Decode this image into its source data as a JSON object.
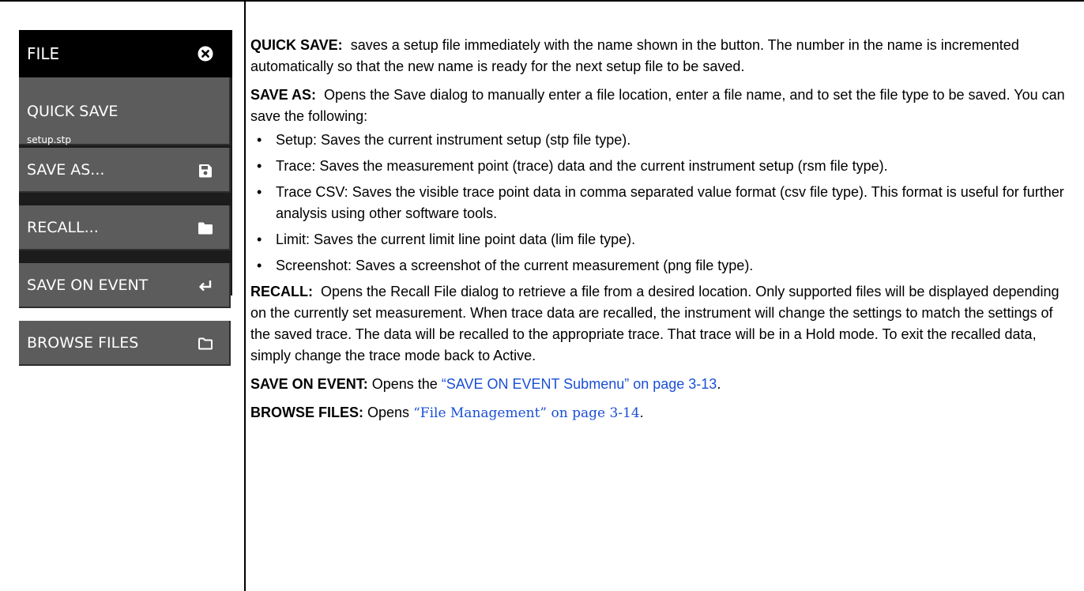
{
  "menu": {
    "title": "FILE",
    "close_icon": "close-circle-icon",
    "items": [
      {
        "label": "QUICK SAVE",
        "sublabel": "setup.stp"
      },
      {
        "label": "SAVE AS...",
        "icon": "save-icon"
      },
      {
        "label": "RECALL...",
        "icon": "folder-filled-icon"
      },
      {
        "label": "SAVE ON EVENT",
        "icon": "enter-arrow-icon"
      },
      {
        "label": "BROWSE FILES",
        "icon": "folder-outline-icon"
      }
    ],
    "colors": {
      "header_bg": "#000000",
      "button_bg": "#5c5c5c",
      "text": "#ffffff"
    }
  },
  "description": {
    "quick_save": {
      "term": "QUICK SAVE:",
      "text": "saves a setup file immediately with the name shown in the button. The number in the name is incremented automatically so that the new name is ready for the next setup file to be saved."
    },
    "save_as": {
      "term": "SAVE AS:",
      "text": "Opens the Save dialog to manually enter a file location, enter a file name, and to set the file type to be saved. You can save the following:",
      "bullets": [
        "Setup: Saves the current instrument setup (stp file type).",
        "Trace: Saves the measurement point (trace) data and the current instrument setup (rsm file type).",
        "Trace CSV: Saves the visible trace point data in comma separated value format (csv file type). This format is useful for further analysis using other software tools.",
        "Limit: Saves the current limit line point data (lim file type).",
        "Screenshot: Saves a screenshot of the current measurement (png file type)."
      ]
    },
    "recall": {
      "term": "RECALL:",
      "text": "Opens the Recall File dialog to retrieve a file from a desired location. Only supported files will be displayed depending on the currently set measurement. When trace data are recalled, the instrument will change the settings to match the settings of the saved trace. The data will be recalled to the appropriate trace. That trace will be in a Hold mode. To exit the recalled data, simply change the trace mode back to Active."
    },
    "save_on_event": {
      "term": "SAVE ON EVENT:",
      "text_before": "Opens the",
      "link": "“SAVE ON EVENT Submenu” on page 3-13",
      "text_after": "."
    },
    "browse_files": {
      "term": "BROWSE FILES:",
      "text_before": "Opens",
      "link": "“File Management” on page 3-14",
      "text_after": "."
    },
    "link_color": "#1a4fd6"
  }
}
